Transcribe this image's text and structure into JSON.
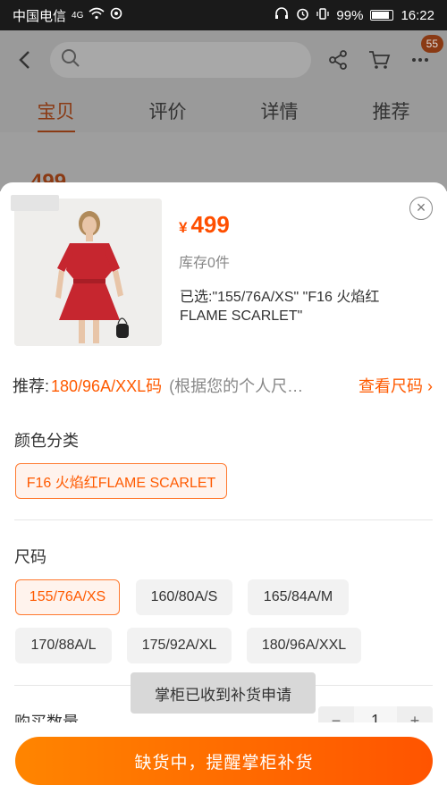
{
  "status_bar": {
    "carrier": "中国电信",
    "network": "4G",
    "battery": "99%",
    "time": "16:22"
  },
  "background": {
    "cart_badge": "55",
    "tabs": [
      "宝贝",
      "评价",
      "详情",
      "推荐"
    ],
    "active_tab_index": 0,
    "price_partial": "499"
  },
  "product": {
    "currency": "¥",
    "price": "499",
    "stock": "库存0件",
    "selected_text": "已选:\"155/76A/XS\" \"F16 火焰红 FLAME SCARLET\"",
    "image_colors": {
      "dress": "#c6262f",
      "background": "#efeeec"
    }
  },
  "recommend": {
    "label": "推荐:",
    "value": "180/96A/XXL码",
    "hint": "(根据您的个人尺…",
    "link": "查看尺码",
    "link_arrow": "›"
  },
  "color_section": {
    "title": "颜色分类",
    "options": [
      "F16 火焰红FLAME SCARLET"
    ],
    "selected_index": 0
  },
  "size_section": {
    "title": "尺码",
    "options": [
      "155/76A/XS",
      "160/80A/S",
      "165/84A/M",
      "170/88A/L",
      "175/92A/XL",
      "180/96A/XXL"
    ],
    "selected_index": 0
  },
  "toast": "掌柜已收到补货申请",
  "quantity": {
    "label": "购买数量",
    "value": "1",
    "minus": "−",
    "plus": "+"
  },
  "cta": "缺货中，提醒掌柜补货",
  "colors": {
    "accent": "#ff5a00",
    "cta_start": "#ff8500",
    "cta_end": "#ff5400"
  }
}
